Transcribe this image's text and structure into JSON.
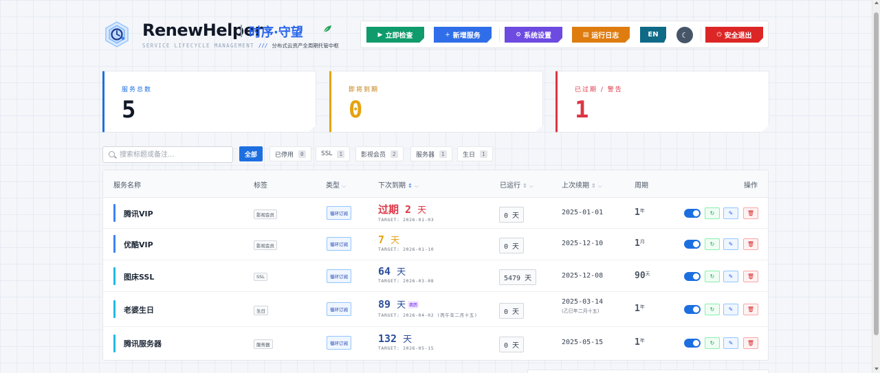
{
  "brand": {
    "name": "RenewHelper",
    "cn_name": "时序·守望",
    "leaf_icon": "leaf-icon",
    "subtitle_en": "SERVICE LIFECYCLE MANAGEMENT",
    "subtitle_sep": "///",
    "subtitle_cn": "分布式云资产全周期托管中枢"
  },
  "toolbar": {
    "check_label": "立即检查",
    "add_label": "新增服务",
    "settings_label": "系统设置",
    "logs_label": "运行日志",
    "lang_label": "EN",
    "logout_label": "安全退出",
    "colors": {
      "check": "#0f9b6c",
      "add": "#2f6ee8",
      "settings": "#6d4ae0",
      "logs": "#df7c10",
      "lang": "#0e6a87",
      "logout": "#dc2626"
    }
  },
  "stats": [
    {
      "label": "服务总数",
      "value": "5",
      "color": "#1d6fe0"
    },
    {
      "label": "即将到期",
      "value": "0",
      "color": "#e5a312"
    },
    {
      "label": "已过期 / 警告",
      "value": "1",
      "color": "#dc3545"
    }
  ],
  "search": {
    "placeholder": "搜索标题或备注..."
  },
  "filters": [
    {
      "label": "全部",
      "count": ""
    },
    {
      "label": "已停用",
      "count": "0"
    },
    {
      "label": "SSL",
      "count": "1"
    },
    {
      "label": "影视会员",
      "count": "2"
    },
    {
      "label": "服务器",
      "count": "1"
    },
    {
      "label": "生日",
      "count": "1"
    }
  ],
  "table": {
    "headers": {
      "name": "服务名称",
      "tags": "标签",
      "type": "类型",
      "next_due": "下次到期",
      "running": "已运行",
      "last_renew": "上次续期",
      "cycle": "周期",
      "actions": "操作"
    },
    "rows": [
      {
        "name": "腾讯VIP",
        "tag": "影视会员",
        "type": "循环订阅",
        "due_value": "过期 2",
        "due_unit": "天",
        "due_color": "#dc3545",
        "target": "TARGET: 2026-01-03",
        "lunar_badge": "",
        "ran": "0 天",
        "last": "2025-01-01",
        "last_sub": "",
        "cycle_num": "1",
        "cycle_unit": "年",
        "bar_color": "#3b82f6"
      },
      {
        "name": "优酷VIP",
        "tag": "影视会员",
        "type": "循环订阅",
        "due_value": "7",
        "due_unit": "天",
        "due_color": "#e5a312",
        "target": "TARGET: 2026-01-10",
        "lunar_badge": "",
        "ran": "0 天",
        "last": "2025-12-10",
        "last_sub": "",
        "cycle_num": "1",
        "cycle_unit": "月",
        "bar_color": "#3b82f6"
      },
      {
        "name": "图床SSL",
        "tag": "SSL",
        "type": "循环订阅",
        "due_value": "64",
        "due_unit": "天",
        "due_color": "#2b4e9b",
        "target": "TARGET: 2026-03-08",
        "lunar_badge": "",
        "ran": "5479 天",
        "last": "2025-12-08",
        "last_sub": "",
        "cycle_num": "90",
        "cycle_unit": "天",
        "bar_color": "#22b8e6"
      },
      {
        "name": "老婆生日",
        "tag": "生日",
        "type": "循环订阅",
        "due_value": "89",
        "due_unit": "天",
        "due_color": "#2b4e9b",
        "target": "TARGET: 2026-04-02 (丙午年二月十五)",
        "lunar_badge": "农历",
        "ran": "0 天",
        "last": "2025-03-14",
        "last_sub": "(乙巳年二月十五)",
        "cycle_num": "1",
        "cycle_unit": "年",
        "bar_color": "#22b8e6"
      },
      {
        "name": "腾讯服务器",
        "tag": "服务器",
        "type": "循环订阅",
        "due_value": "132",
        "due_unit": "天",
        "due_color": "#2b4e9b",
        "target": "TARGET: 2026-05-15",
        "lunar_badge": "",
        "ran": "0 天",
        "last": "2025-05-15",
        "last_sub": "",
        "cycle_num": "1",
        "cycle_unit": "年",
        "bar_color": "#22b8e6"
      }
    ]
  }
}
